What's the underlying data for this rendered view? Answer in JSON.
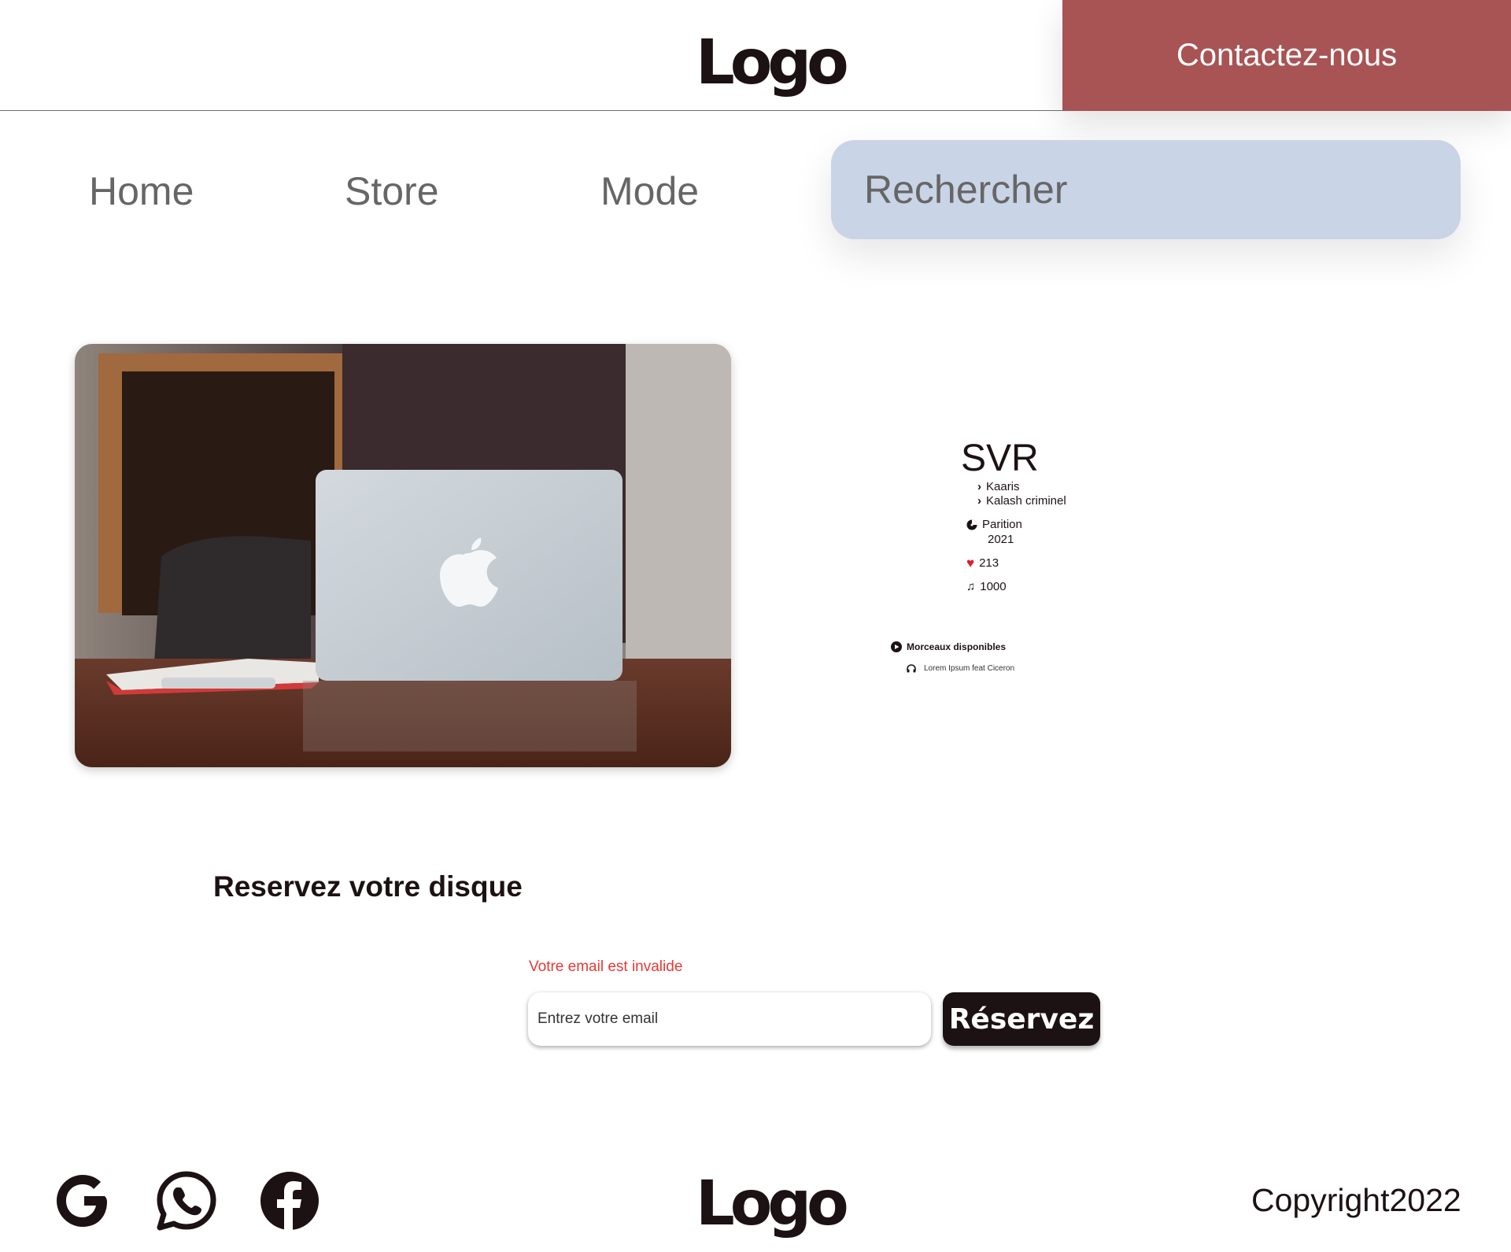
{
  "header": {
    "logo": "Logo",
    "contact_label": "Contactez-nous"
  },
  "nav": {
    "items": [
      {
        "label": "Home"
      },
      {
        "label": "Store"
      },
      {
        "label": "Mode"
      }
    ],
    "search_placeholder": "Rechercher"
  },
  "album": {
    "title": "SVR",
    "artists": [
      "Kaaris",
      "Kalash criminel"
    ],
    "label": "Parition",
    "year": "2021",
    "likes": "213",
    "plays": "1000",
    "tracks_heading": "Morceaux disponibles",
    "tracks": [
      "Lorem Ipsum feat Ciceron"
    ]
  },
  "reserve": {
    "title": "Reservez votre disque",
    "error": "Votre email est invalide",
    "email_placeholder": "Entrez votre email",
    "button_label": "Réservez"
  },
  "footer": {
    "logo": "Logo",
    "copyright": "Copyright2022",
    "social": [
      "google-icon",
      "whatsapp-icon",
      "facebook-icon"
    ]
  },
  "colors": {
    "accent": "#a85354",
    "search_bg": "#c9d4e6",
    "dark": "#1d1213",
    "error": "#e53935"
  }
}
